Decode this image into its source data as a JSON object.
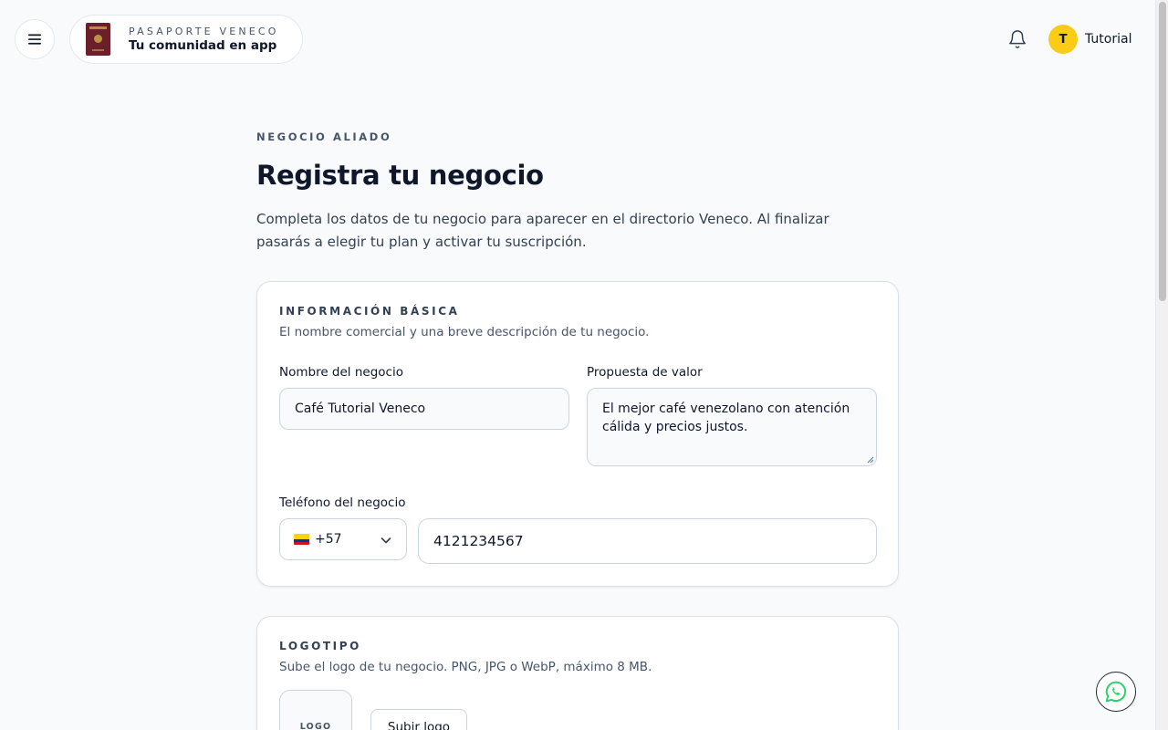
{
  "header": {
    "menu_icon": "menu-icon",
    "brand_eyebrow": "PASAPORTE VENECO",
    "brand_title": "Tu comunidad en app",
    "notification_icon": "bell-icon",
    "user_initial": "T",
    "user_name": "Tutorial"
  },
  "main": {
    "eyebrow": "NEGOCIO ALIADO",
    "title": "Registra tu negocio",
    "description": "Completa los datos de tu negocio para aparecer en el directorio Veneco. Al finalizar pasarás a elegir tu plan y activar tu suscripción."
  },
  "basic_info": {
    "section_title": "INFORMACIÓN BÁSICA",
    "section_desc": "El nombre comercial y una breve descripción de tu negocio.",
    "name_label": "Nombre del negocio",
    "name_value": "Café Tutorial Veneco",
    "value_prop_label": "Propuesta de valor",
    "value_prop_value": "El mejor café venezolano con atención cálida y precios justos.",
    "phone_label": "Teléfono del negocio",
    "country_code": "+57",
    "phone_value": "4121234567"
  },
  "logo": {
    "section_title": "LOGOTIPO",
    "section_desc": "Sube el logo de tu negocio. PNG, JPG o WebP, máximo 8 MB.",
    "placeholder": "LOGO",
    "upload_button": "Subir logo"
  },
  "floating": {
    "whatsapp_icon": "whatsapp-icon"
  },
  "colors": {
    "avatar": "#facc15",
    "whatsapp": "#25d366",
    "passport": "#6b1f2a"
  }
}
